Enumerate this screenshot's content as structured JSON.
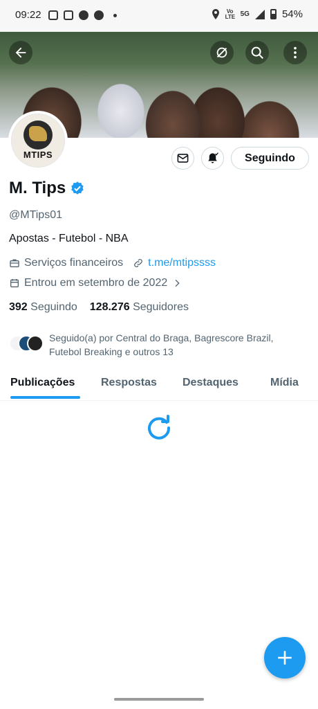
{
  "status_bar": {
    "time": "09:22",
    "volte": "Vo LTE",
    "network": "5G",
    "battery": "54%"
  },
  "profile": {
    "name": "M. Tips",
    "handle": "@MTips01",
    "avatar_text": "MTIPS",
    "bio": "Apostas - Futebol - NBA",
    "category": "Serviços financeiros",
    "link": "t.me/mtipssss",
    "joined": "Entrou em setembro de 2022",
    "following_count": "392",
    "following_label": "Seguindo",
    "followers_count": "128.276",
    "followers_label": "Seguidores",
    "followed_by": "Seguido(a) por Central do Braga, Bagrescore Brazil, Futebol Breaking e outros 13"
  },
  "actions": {
    "follow_button": "Seguindo"
  },
  "tabs": [
    {
      "label": "Publicações",
      "active": true
    },
    {
      "label": "Respostas",
      "active": false
    },
    {
      "label": "Destaques",
      "active": false
    },
    {
      "label": "Mídia",
      "active": false
    }
  ],
  "colors": {
    "accent": "#1d9bf0",
    "text": "#0f1419",
    "secondary": "#536471"
  },
  "icons": [
    "back-arrow-icon",
    "grok-icon",
    "search-icon",
    "more-icon",
    "mail-icon",
    "bell-icon",
    "verified-icon",
    "briefcase-icon",
    "link-icon",
    "calendar-icon",
    "chevron-right-icon",
    "refresh-icon",
    "plus-icon"
  ]
}
